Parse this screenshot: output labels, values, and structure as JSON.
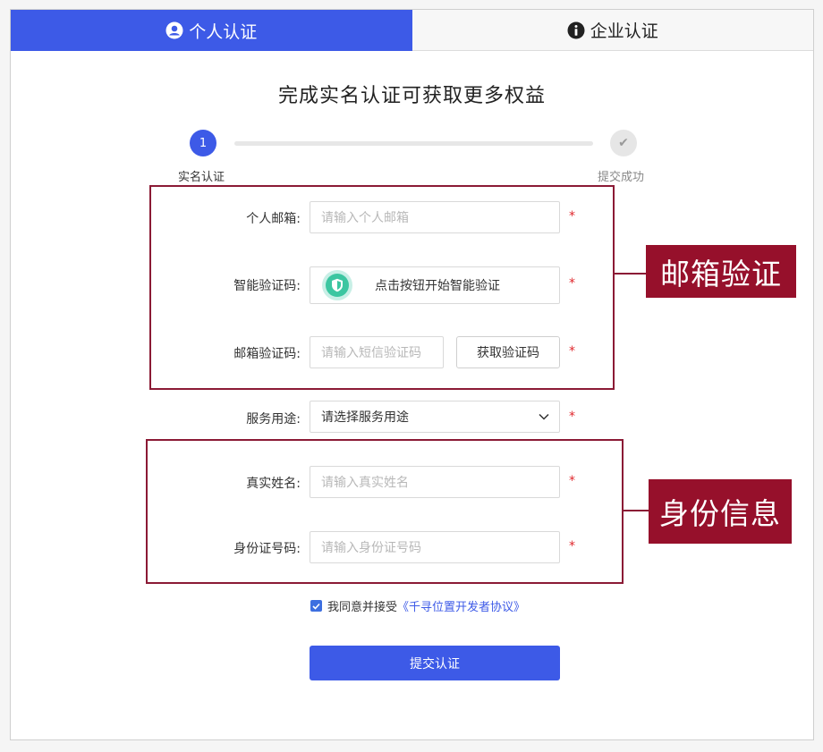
{
  "tabs": [
    {
      "label": "个人认证",
      "icon": "user-circle-icon",
      "active": true
    },
    {
      "label": "企业认证",
      "icon": "info-circle-icon",
      "active": false
    }
  ],
  "page_title": "完成实名认证可获取更多权益",
  "steps": [
    {
      "number": "1",
      "label": "实名认证",
      "status": "current"
    },
    {
      "number": "✔",
      "label": "提交成功",
      "status": "pending"
    }
  ],
  "form": {
    "email": {
      "label": "个人邮箱:",
      "placeholder": "请输入个人邮箱",
      "value": ""
    },
    "smart_captcha": {
      "label": "智能验证码:",
      "button_text": "点击按钮开始智能验证"
    },
    "email_code": {
      "label": "邮箱验证码:",
      "placeholder": "请输入短信验证码",
      "value": "",
      "get_code_label": "获取验证码"
    },
    "service_usage": {
      "label": "服务用途:",
      "selected": "请选择服务用途"
    },
    "real_name": {
      "label": "真实姓名:",
      "placeholder": "请输入真实姓名",
      "value": ""
    },
    "id_number": {
      "label": "身份证号码:",
      "placeholder": "请输入身份证号码",
      "value": ""
    },
    "required_mark": "*",
    "agreement": {
      "checked": true,
      "prefix": "我同意并接受",
      "link_text": "《千寻位置开发者协议》"
    },
    "submit_label": "提交认证"
  },
  "annotations": {
    "email_section": "邮箱验证",
    "identity_section": "身份信息",
    "color": "#96102b"
  },
  "colors": {
    "primary": "#3d5ae7",
    "required": "#e0282d",
    "captcha": "#3cc6a1"
  }
}
